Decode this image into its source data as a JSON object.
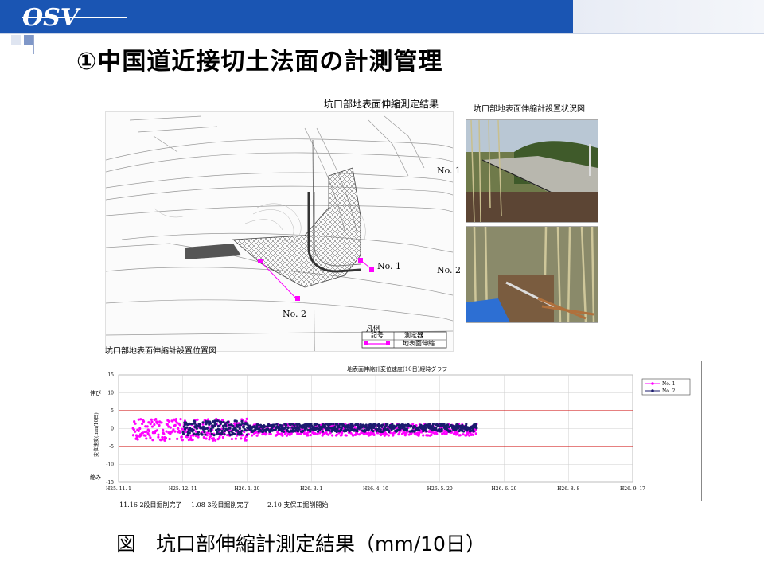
{
  "header": {
    "logo_text": "OSV",
    "colors": {
      "bar": "#1a55b3",
      "title": "#000000"
    }
  },
  "slide": {
    "title": "①中国道近接切土法面の計測管理"
  },
  "map": {
    "heading": "坑口部地表面伸縮測定結果",
    "caption": "坑口部地表面伸縮計設置位置図",
    "labels": {
      "no1_right": "No. 1",
      "no2_right": "No. 2",
      "no1_mid": "No. 1",
      "no2_bottom": "No. 2"
    },
    "legend": {
      "title": "凡例",
      "col_symbol": "記号",
      "col_instrument": "測定器",
      "row_instrument": "地表面伸縮"
    }
  },
  "photos": {
    "title": "坑口部地表面伸縮計設置状況図",
    "photo1_icon": "slope-photo",
    "photo2_icon": "bamboo-forest-photo"
  },
  "chart_data": {
    "type": "scatter",
    "title": "地表面伸縮計変位速度(10日)経時グラフ",
    "ylabel": "変位速度(mm/10日)",
    "y_top_label": "伸び",
    "y_bottom_label": "縮み",
    "ylim": [
      -15,
      15
    ],
    "yticks": [
      15,
      10,
      5,
      0,
      -5,
      -10,
      -15
    ],
    "reference_lines": [
      5,
      -5
    ],
    "x_ticks": [
      "H25. 11. 1",
      "H25. 12. 11",
      "H26. 1. 20",
      "H26. 3. 1",
      "H26. 4. 10",
      "H26. 5. 20",
      "H26. 6. 29",
      "H26. 8. 8",
      "H26. 9. 17"
    ],
    "grid": true,
    "legend_position": "top-right",
    "series": [
      {
        "name": "No. 1",
        "color": "#ff00ff",
        "x_start": "H25. 11. 21",
        "x_end": "H26. 7. 18",
        "y_min": -3,
        "y_max": 3
      },
      {
        "name": "No. 2",
        "color": "#1b1b6e",
        "x_start": "H25. 12. 11",
        "x_end": "H26. 7. 18",
        "y_min": -2,
        "y_max": 2
      }
    ],
    "annotations": [
      "11.16 2段目掘削完了",
      "1.08 3段目掘削完了",
      "2.10 支保工掘削開始"
    ]
  },
  "figure_caption": "図　坑口部伸縮計測定結果（mm/10日）"
}
